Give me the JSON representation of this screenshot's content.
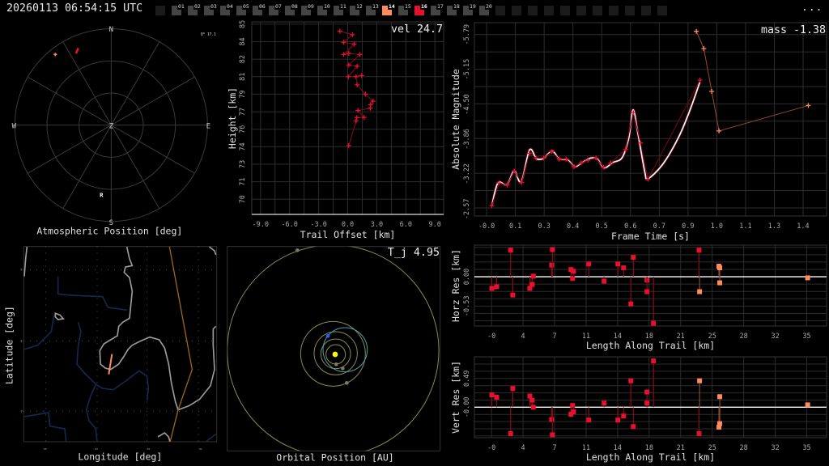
{
  "header": {
    "timestamp": "20260113 06:54:15 UTC",
    "menu": "...",
    "frames": [
      {
        "label": "",
        "state": "off"
      },
      {
        "label": "01",
        "state": "idle"
      },
      {
        "label": "02",
        "state": "idle"
      },
      {
        "label": "03",
        "state": "idle"
      },
      {
        "label": "04",
        "state": "idle"
      },
      {
        "label": "05",
        "state": "idle"
      },
      {
        "label": "06",
        "state": "idle"
      },
      {
        "label": "07",
        "state": "idle"
      },
      {
        "label": "08",
        "state": "idle"
      },
      {
        "label": "09",
        "state": "idle"
      },
      {
        "label": "10",
        "state": "idle"
      },
      {
        "label": "11",
        "state": "idle"
      },
      {
        "label": "12",
        "state": "idle"
      },
      {
        "label": "13",
        "state": "idle"
      },
      {
        "label": "14",
        "state": "orange"
      },
      {
        "label": "15",
        "state": "idle"
      },
      {
        "label": "16",
        "state": "red"
      },
      {
        "label": "17",
        "state": "idle"
      },
      {
        "label": "18",
        "state": "idle"
      },
      {
        "label": "19",
        "state": "idle"
      },
      {
        "label": "20",
        "state": "idle"
      },
      {
        "label": "",
        "state": "off"
      },
      {
        "label": "",
        "state": "off"
      },
      {
        "label": "",
        "state": "off"
      },
      {
        "label": "",
        "state": "off"
      },
      {
        "label": "",
        "state": "off"
      },
      {
        "label": "",
        "state": "off"
      },
      {
        "label": "",
        "state": "off"
      },
      {
        "label": "",
        "state": "off"
      },
      {
        "label": "",
        "state": "off"
      },
      {
        "label": "",
        "state": "off"
      },
      {
        "label": "",
        "state": "off"
      }
    ]
  },
  "colors": {
    "station1": "#e8102e",
    "station2": "#ff8a5c",
    "fit": "#ffffff",
    "grid": "#2c2c2c",
    "coast": "#9a9a9a",
    "river": "#13284d",
    "border": "#a0641e",
    "orbit": "#8c8c50",
    "meteor_orbit": "#4aa0b4",
    "sun": "#ffff00",
    "earth": "#1e64ff"
  },
  "polar": {
    "title": "Atmospheric Position [deg]",
    "metric": "Q* 17.1",
    "n": "N",
    "s": "S",
    "e": "E",
    "w": "W",
    "z": "Z",
    "r": "R"
  },
  "map": {
    "xlabel": "Longitude [deg]",
    "ylabel": "Latitude [deg]",
    "xticks": [
      "-85",
      "-84",
      "-83",
      "-82"
    ],
    "yticks": [
      "45",
      "44",
      "43"
    ]
  },
  "orbit": {
    "title": "Orbital Position [AU]",
    "metric": "T_j 4.95"
  },
  "chart_data": [
    {
      "id": "height",
      "type": "line",
      "metric": "vel 24.7",
      "xlabel": "Trail Offset [km]",
      "ylabel": "Height [km]",
      "xlim": [
        -9.9,
        9.9
      ],
      "ylim": [
        68.7,
        85.2
      ],
      "xticks": [
        {
          "v": -9,
          "label": "-9.0"
        },
        {
          "v": -6,
          "label": "-6.0"
        },
        {
          "v": -3,
          "label": "-3.0"
        },
        {
          "v": 0,
          "label": "0.0"
        },
        {
          "v": 3,
          "label": "3.0"
        },
        {
          "v": 6,
          "label": "6.0"
        },
        {
          "v": 9,
          "label": "9.0"
        }
      ],
      "yticks": [
        {
          "v": 85,
          "label": "85"
        },
        {
          "v": 83.5,
          "label": "84"
        },
        {
          "v": 82,
          "label": "82"
        },
        {
          "v": 80.5,
          "label": "81"
        },
        {
          "v": 79,
          "label": "79"
        },
        {
          "v": 77.5,
          "label": "77"
        },
        {
          "v": 76,
          "label": "76"
        },
        {
          "v": 74.5,
          "label": "74"
        },
        {
          "v": 73,
          "label": "73"
        },
        {
          "v": 71.5,
          "label": "71"
        },
        {
          "v": 70,
          "label": "70"
        }
      ],
      "series": [
        {
          "name": "station 16",
          "kind": "trail",
          "color": "#e8102e",
          "line": "#8b0a1e",
          "points": [
            [
              -0.81,
              84.4
            ],
            [
              0.5,
              84.1
            ],
            [
              -0.42,
              83.45
            ],
            [
              0.67,
              83.3
            ],
            [
              -0.42,
              82.4
            ],
            [
              0.11,
              82.5
            ],
            [
              1.25,
              82.4
            ],
            [
              0.11,
              81.5
            ],
            [
              0.97,
              81.4
            ],
            [
              0.06,
              80.5
            ],
            [
              1.44,
              80.6
            ],
            [
              0.86,
              80.5
            ],
            [
              0.97,
              79.8
            ],
            [
              1.83,
              79.0
            ],
            [
              2.61,
              78.4
            ],
            [
              2.36,
              78.1
            ],
            [
              2.33,
              77.8
            ],
            [
              1.06,
              77.6
            ],
            [
              1.69,
              77.0
            ],
            [
              0.94,
              77.0
            ],
            [
              0.86,
              76.7
            ],
            [
              0.11,
              74.6
            ]
          ]
        }
      ]
    },
    {
      "id": "magnitude",
      "type": "line",
      "metric": "mass -1.38",
      "xlabel": "Frame Time [s]",
      "ylabel": "Absolute Magnitude",
      "xlim": [
        -0.054,
        1.504
      ],
      "ylim": [
        -6.01,
        -2.44
      ],
      "y_inverted": true,
      "xticks": [
        {
          "v": 0,
          "label": "-0.0"
        },
        {
          "v": 0.1273,
          "label": "0.1"
        },
        {
          "v": 0.2545,
          "label": "0.3"
        },
        {
          "v": 0.3818,
          "label": "0.4"
        },
        {
          "v": 0.5091,
          "label": "0.5"
        },
        {
          "v": 0.6364,
          "label": "0.6"
        },
        {
          "v": 0.7636,
          "label": "0.7"
        },
        {
          "v": 0.8909,
          "label": "0.9"
        },
        {
          "v": 1.0182,
          "label": "1.0"
        },
        {
          "v": 1.1455,
          "label": "1.1"
        },
        {
          "v": 1.2727,
          "label": "1.3"
        },
        {
          "v": 1.4,
          "label": "1.4"
        }
      ],
      "yticks": [
        {
          "v": -5.79,
          "label": "-5.79"
        },
        {
          "v": -5.15,
          "label": "-5.15"
        },
        {
          "v": -4.5,
          "label": "-4.50"
        },
        {
          "v": -3.86,
          "label": "-3.86"
        },
        {
          "v": -3.22,
          "label": "-3.22"
        },
        {
          "v": -2.57,
          "label": "-2.57"
        }
      ],
      "series": [
        {
          "name": "station 16",
          "kind": "trail",
          "color": "#e8102e",
          "line": "#7a0818",
          "points": [
            [
              0.023,
              -2.63
            ],
            [
              0.055,
              -3.05
            ],
            [
              0.091,
              -3.01
            ],
            [
              0.122,
              -3.27
            ],
            [
              0.155,
              -3.06
            ],
            [
              0.189,
              -3.6
            ],
            [
              0.219,
              -3.51
            ],
            [
              0.252,
              -3.51
            ],
            [
              0.289,
              -3.63
            ],
            [
              0.321,
              -3.49
            ],
            [
              0.352,
              -3.49
            ],
            [
              0.387,
              -3.35
            ],
            [
              0.418,
              -3.42
            ],
            [
              0.448,
              -3.47
            ],
            [
              0.484,
              -3.51
            ],
            [
              0.517,
              -3.34
            ],
            [
              0.549,
              -3.42
            ],
            [
              0.615,
              -3.67
            ],
            [
              0.649,
              -4.35
            ],
            [
              0.681,
              -3.79
            ],
            [
              0.714,
              -3.12
            ],
            [
              0.944,
              -4.95
            ]
          ]
        },
        {
          "name": "station 14",
          "kind": "trail",
          "color": "#ff8a5c",
          "line": "#9a4a28",
          "points": [
            [
              0.928,
              -5.85
            ],
            [
              0.961,
              -5.53
            ],
            [
              0.996,
              -4.74
            ],
            [
              1.028,
              -4.01
            ],
            [
              1.423,
              -4.48
            ]
          ]
        },
        {
          "name": "fit",
          "kind": "fit",
          "color": "#ffffff",
          "points": [
            [
              0.023,
              -2.63
            ],
            [
              0.05,
              -3.05
            ],
            [
              0.09,
              -3.02
            ],
            [
              0.122,
              -3.27
            ],
            [
              0.153,
              -3.07
            ],
            [
              0.19,
              -3.66
            ],
            [
              0.22,
              -3.5
            ],
            [
              0.25,
              -3.5
            ],
            [
              0.29,
              -3.64
            ],
            [
              0.32,
              -3.5
            ],
            [
              0.36,
              -3.47
            ],
            [
              0.39,
              -3.35
            ],
            [
              0.42,
              -3.42
            ],
            [
              0.46,
              -3.51
            ],
            [
              0.49,
              -3.49
            ],
            [
              0.52,
              -3.33
            ],
            [
              0.56,
              -3.43
            ],
            [
              0.6,
              -3.52
            ],
            [
              0.63,
              -3.9
            ],
            [
              0.648,
              -4.4
            ],
            [
              0.67,
              -3.95
            ],
            [
              0.7,
              -3.25
            ],
            [
              0.714,
              -3.13
            ],
            [
              0.78,
              -3.4
            ],
            [
              0.85,
              -3.9
            ],
            [
              0.9,
              -4.4
            ],
            [
              0.944,
              -4.92
            ]
          ]
        }
      ]
    },
    {
      "id": "horz_res",
      "type": "scatter",
      "metric": "",
      "xlabel": "Length Along Trail [km]",
      "ylabel": "Horz Res [km]",
      "xlim": [
        -1.9,
        37.2
      ],
      "ylim": [
        -0.89,
        0.57
      ],
      "xticks": [
        {
          "v": 0,
          "label": "-0"
        },
        {
          "v": 3.5,
          "label": "4"
        },
        {
          "v": 7,
          "label": "7"
        },
        {
          "v": 10.5,
          "label": "11"
        },
        {
          "v": 14,
          "label": "14"
        },
        {
          "v": 17.5,
          "label": "18"
        },
        {
          "v": 21,
          "label": "21"
        },
        {
          "v": 24.5,
          "label": "25"
        },
        {
          "v": 28,
          "label": "28"
        },
        {
          "v": 31.5,
          "label": "32"
        },
        {
          "v": 35,
          "label": "35"
        }
      ],
      "yticks": [
        {
          "v": -0.53,
          "label": "-0.53"
        },
        {
          "v": 0,
          "label": "0.00"
        }
      ],
      "series": [
        {
          "name": "station 16",
          "kind": "stems",
          "color": "#e8102e",
          "line": "#8b0a1e",
          "points": [
            [
              0.03,
              -0.21
            ],
            [
              0.57,
              -0.18
            ],
            [
              2.12,
              0.48
            ],
            [
              2.36,
              -0.33
            ],
            [
              4.25,
              -0.21
            ],
            [
              4.52,
              -0.14
            ],
            [
              4.64,
              0.01
            ],
            [
              6.67,
              0.21
            ],
            [
              6.76,
              0.49
            ],
            [
              8.82,
              0.13
            ],
            [
              9.0,
              -0.03
            ],
            [
              9.1,
              0.1
            ],
            [
              10.8,
              0.23
            ],
            [
              12.5,
              -0.08
            ],
            [
              14.03,
              0.23
            ],
            [
              14.66,
              0.16
            ],
            [
              15.47,
              -0.49
            ],
            [
              15.74,
              0.35
            ],
            [
              17.26,
              -0.06
            ],
            [
              17.26,
              -0.27
            ],
            [
              17.98,
              -0.84
            ],
            [
              23.04,
              0.48
            ]
          ]
        },
        {
          "name": "station 14",
          "kind": "stems",
          "color": "#ff8a5c",
          "line": "#8a4a2e",
          "points": [
            [
              23.1,
              -0.27
            ],
            [
              25.25,
              0.19
            ],
            [
              25.34,
              0.16
            ],
            [
              25.34,
              -0.11
            ],
            [
              35.1,
              -0.02
            ]
          ]
        }
      ]
    },
    {
      "id": "vert_res",
      "type": "scatter",
      "metric": "",
      "xlabel": "Length Along Trail [km]",
      "ylabel": "Vert Res [km]",
      "xlim": [
        -1.9,
        37.2
      ],
      "ylim": [
        -0.52,
        0.86
      ],
      "xticks": [
        {
          "v": 0,
          "label": "-0"
        },
        {
          "v": 3.5,
          "label": "4"
        },
        {
          "v": 7,
          "label": "7"
        },
        {
          "v": 10.5,
          "label": "11"
        },
        {
          "v": 14,
          "label": "14"
        },
        {
          "v": 17.5,
          "label": "18"
        },
        {
          "v": 21,
          "label": "21"
        },
        {
          "v": 24.5,
          "label": "25"
        },
        {
          "v": 28,
          "label": "28"
        },
        {
          "v": 31.5,
          "label": "32"
        },
        {
          "v": 35,
          "label": "35"
        }
      ],
      "yticks": [
        {
          "v": 0,
          "label": "-0.00"
        },
        {
          "v": 0.49,
          "label": "0.49"
        }
      ],
      "series": [
        {
          "name": "station 16",
          "kind": "stems",
          "color": "#e8102e",
          "line": "#8b0a1e",
          "points": [
            [
              0.03,
              0.21
            ],
            [
              0.57,
              0.17
            ],
            [
              2.12,
              -0.45
            ],
            [
              2.36,
              0.32
            ],
            [
              4.25,
              0.19
            ],
            [
              4.52,
              0.12
            ],
            [
              4.64,
              0.0
            ],
            [
              6.67,
              -0.21
            ],
            [
              6.76,
              -0.47
            ],
            [
              8.82,
              -0.12
            ],
            [
              9.0,
              0.03
            ],
            [
              9.1,
              -0.08
            ],
            [
              10.8,
              -0.22
            ],
            [
              12.5,
              0.07
            ],
            [
              14.03,
              -0.22
            ],
            [
              14.66,
              -0.15
            ],
            [
              15.47,
              0.45
            ],
            [
              15.74,
              -0.33
            ],
            [
              17.26,
              0.26
            ],
            [
              17.26,
              0.07
            ],
            [
              17.98,
              0.79
            ],
            [
              23.04,
              -0.45
            ]
          ]
        },
        {
          "name": "station 14",
          "kind": "stems",
          "color": "#ff8a5c",
          "line": "#8a4a2e",
          "points": [
            [
              23.1,
              0.45
            ],
            [
              25.25,
              -0.34
            ],
            [
              25.34,
              -0.28
            ],
            [
              25.34,
              0.18
            ],
            [
              35.1,
              0.04
            ]
          ]
        }
      ]
    }
  ]
}
